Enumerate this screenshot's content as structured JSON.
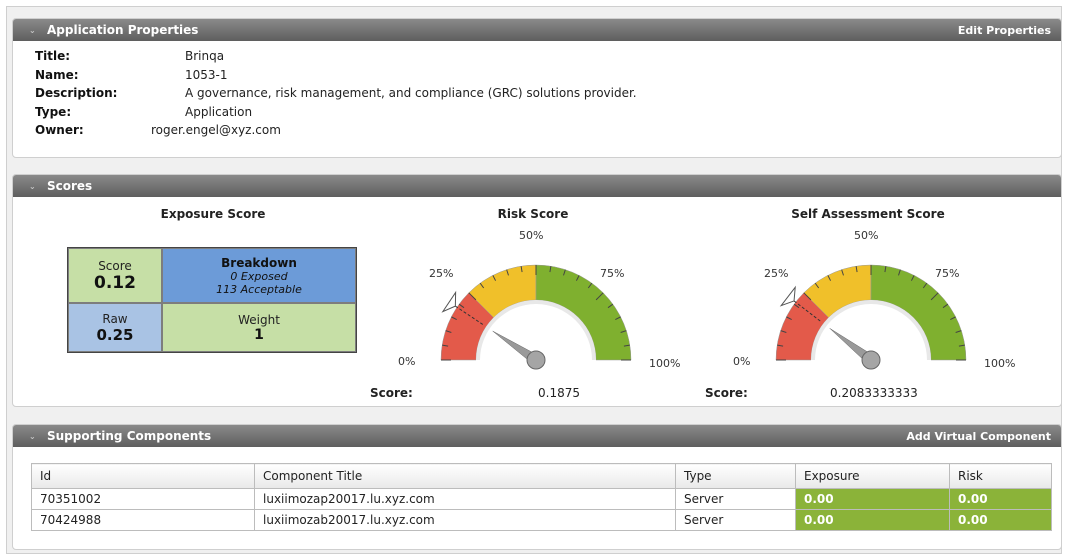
{
  "app_properties": {
    "header": "Application Properties",
    "edit_link": "Edit Properties",
    "fields": [
      {
        "label": "Title:",
        "value": "Brinqa"
      },
      {
        "label": "Name:",
        "value": "1053-1"
      },
      {
        "label": "Description:",
        "value": "A governance, risk management, and compliance (GRC) solutions provider."
      },
      {
        "label": "Type:",
        "value": "Application"
      },
      {
        "label": "Owner:",
        "value": "roger.engel@xyz.com"
      }
    ]
  },
  "scores": {
    "header": "Scores",
    "exposure": {
      "title": "Exposure Score",
      "score_label": "Score",
      "score_value": "0.12",
      "breakdown_label": "Breakdown",
      "exposed": "0 Exposed",
      "acceptable": "113 Acceptable",
      "raw_label": "Raw",
      "raw_value": "0.25",
      "weight_label": "Weight",
      "weight_value": "1"
    },
    "risk": {
      "title": "Risk Score",
      "ticks": {
        "p0": "0%",
        "p25": "25%",
        "p50": "50%",
        "p75": "75%",
        "p100": "100%"
      },
      "score_label": "Score:",
      "score_value": "0.1875",
      "value": 0.1875
    },
    "self_assessment": {
      "title": "Self Assessment Score",
      "ticks": {
        "p0": "0%",
        "p25": "25%",
        "p50": "50%",
        "p75": "75%",
        "p100": "100%"
      },
      "score_label": "Score:",
      "score_value": "0.2083333333",
      "value": 0.2083333333
    },
    "colors": {
      "red": "#e35a4a",
      "yellow": "#f0c02a",
      "green": "#7fb02f"
    }
  },
  "components": {
    "header": "Supporting Components",
    "add_link": "Add Virtual Component",
    "columns": [
      "Id",
      "Component Title",
      "Type",
      "Exposure",
      "Risk"
    ],
    "rows": [
      {
        "id": "70351002",
        "title": "luxiimozap20017.lu.xyz.com",
        "type": "Server",
        "exposure": "0.00",
        "risk": "0.00"
      },
      {
        "id": "70424988",
        "title": "luxiimozab20017.lu.xyz.com",
        "type": "Server",
        "exposure": "0.00",
        "risk": "0.00"
      }
    ]
  }
}
